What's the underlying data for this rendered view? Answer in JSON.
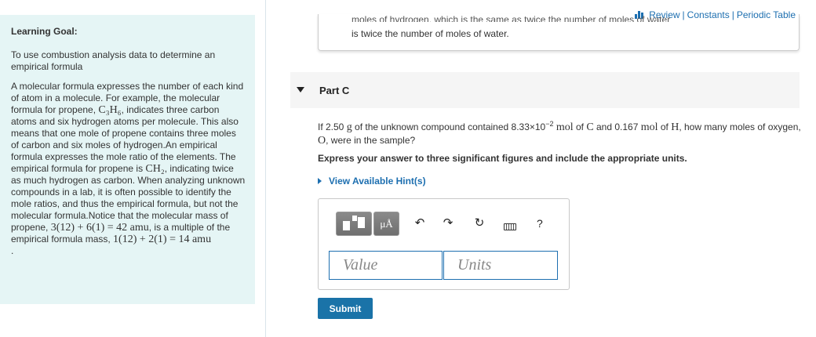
{
  "top_links": {
    "review": "Review",
    "separator": "|",
    "constants": "Constants",
    "periodic_table": "Periodic Table"
  },
  "learning_goal": {
    "title": "Learning Goal:",
    "text": "To use combustion analysis data to determine an empirical formula"
  },
  "intro": {
    "t1": "A molecular formula expresses the number of each kind of atom in a molecule. For example, the molecular formula for propene, ",
    "f1": "C₃H₆",
    "t2": ", indicates three carbon atoms and six hydrogen atoms per molecule. This also means that one mole of propene contains three moles of carbon and six moles of hydrogen.An empirical formula expresses the mole ratio of the elements. The empirical formula for propene is ",
    "f2": "CH₂",
    "t3": ", indicating twice as much hydrogen as carbon. When analyzing unknown compounds in a lab, it is often possible to identify the mole ratios, and thus the empirical formula, but not the molecular formula.Notice that the molecular mass of propene, ",
    "f3": "3(12) + 6(1) = 42 amu",
    "t4": ", is a multiple of the empirical formula mass, ",
    "f4": "1(12) + 2(1) = 14 amu",
    "t5": "."
  },
  "previous_card": {
    "cut_text": "moles of hydrogen, which is the same as twice the number of moles of water",
    "line": "is twice the number of moles of water."
  },
  "part": {
    "title": "Part C",
    "q1": "If 2.50 ",
    "m1": "g",
    "q2": " of the unknown compound contained 8.33×10",
    "exp": "−2",
    "q3": " ",
    "m2": "mol",
    "q4": " of ",
    "m3": "C",
    "q5": " and 0.167 ",
    "m4": "mol",
    "q6": " of ",
    "m5": "H",
    "q7": ", how many moles of oxygen, ",
    "m6": "O",
    "q8": ", were in the sample?",
    "instruction": "Express your answer to three significant figures and include the appropriate units.",
    "hint": "View Available Hint(s)"
  },
  "toolbar": {
    "units_button": "μÅ",
    "help": "?"
  },
  "answer": {
    "value_placeholder": "Value",
    "units_placeholder": "Units"
  },
  "submit_label": "Submit",
  "colors": {
    "link": "#1d6fb0",
    "panel_bg": "#e5f5f5",
    "submit_bg": "#1a73a8"
  }
}
